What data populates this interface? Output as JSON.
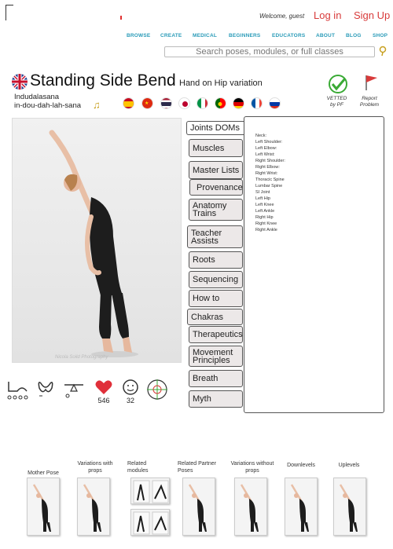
{
  "header": {
    "welcome": "Welcome, guest",
    "login": "Log in",
    "signup": "Sign Up"
  },
  "nav": [
    "BROWSE",
    "CREATE",
    "MEDICAL",
    "BEGINNERS",
    "EDUCATORS",
    "ABOUT",
    "BLOG",
    "SHOP"
  ],
  "search": {
    "placeholder": "Search poses, modules, or full classes"
  },
  "pose": {
    "title": "Standing Side Bend",
    "variation": "Hand on Hip variation",
    "sanskrit": "Indudalasana",
    "phonetic": "in-dou-dah-lah-sana"
  },
  "languages": [
    "spanish",
    "chinese",
    "thai",
    "japanese",
    "italian",
    "portuguese",
    "german",
    "french",
    "russian"
  ],
  "badges": {
    "vetted_line1": "VETTED",
    "vetted_line2": "by PF",
    "report_line1": "Report",
    "report_line2": "Problem"
  },
  "photo": {
    "credit": "Nicola Soild Photography"
  },
  "tabs": [
    "Joints DOMs",
    "Muscles",
    "Master Lists",
    "Provenance",
    "Anatomy Trains",
    "Teacher Assists",
    "Roots",
    "Sequencing",
    "How to",
    "Chakras",
    "Therapeutics",
    "Movement Principles",
    "Breath",
    "Myth"
  ],
  "joints": [
    "Neck:",
    "Left Shoulder:",
    "Left Elbow:",
    "Left Wrist:",
    "Right Shoulder:",
    "Right Elbow:",
    "Right Wrist:",
    "Thoracic Spine",
    "Lumbar Spine",
    "SI Joint",
    "Left Hip",
    "Left Knee",
    "Left Ankle",
    "Right Hip",
    "Right Knee",
    "Right Ankle"
  ],
  "stats": {
    "likes": "546",
    "smiles": "32"
  },
  "related": {
    "mother": "Mother Pose",
    "variations_props": "Variations with props",
    "modules": "Related modules",
    "partner": "Related Partner Poses",
    "variations_no_props": "Variations without props",
    "downlevels": "Downlevels",
    "uplevels": "Uplevels"
  },
  "colors": {
    "accent_red": "#d83a3a",
    "nav_teal": "#2a9bb8",
    "vetted_green": "#3aaa35",
    "gold": "#c8a020"
  }
}
